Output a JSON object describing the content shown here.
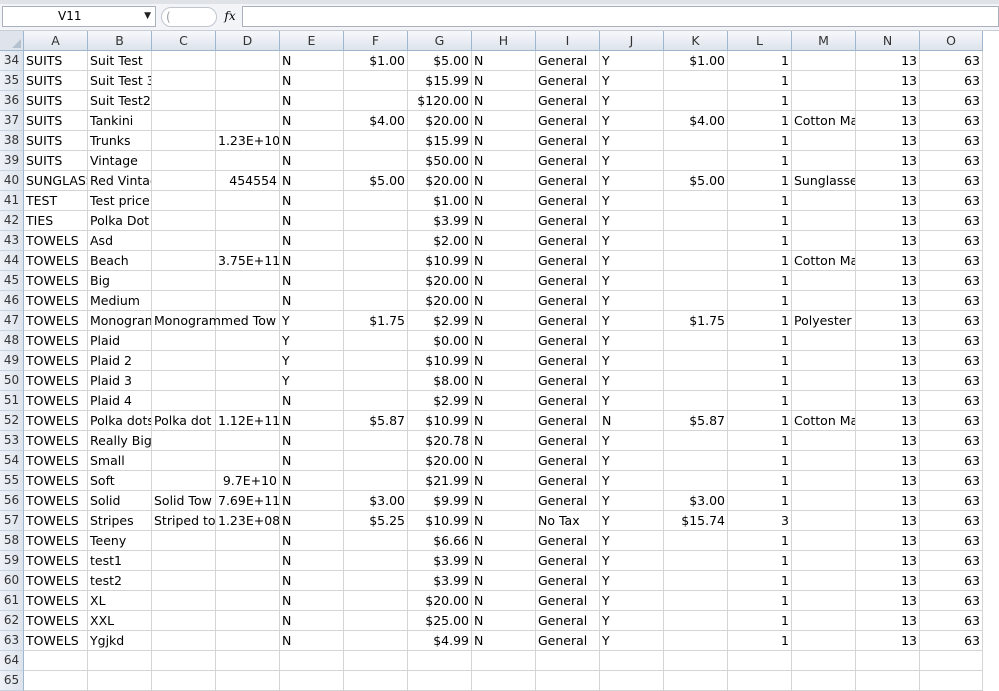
{
  "formula_bar": {
    "name_box": "V11",
    "fx_label": "fx",
    "formula": ""
  },
  "columns": [
    "A",
    "B",
    "C",
    "D",
    "E",
    "F",
    "G",
    "H",
    "I",
    "J",
    "K",
    "L",
    "M",
    "N",
    "O"
  ],
  "rows": [
    {
      "num": "34",
      "cells": [
        "SUITS",
        "Suit Test",
        "",
        "",
        "N",
        "$1.00",
        "$5.00",
        "N",
        "General",
        "Y",
        "$1.00",
        "1",
        "",
        "13",
        "63"
      ]
    },
    {
      "num": "35",
      "cells": [
        "SUITS",
        "Suit Test 3",
        "",
        "",
        "N",
        "",
        "$15.99",
        "N",
        "General",
        "Y",
        "",
        "1",
        "",
        "13",
        "63"
      ]
    },
    {
      "num": "36",
      "cells": [
        "SUITS",
        "Suit Test2",
        "",
        "",
        "N",
        "",
        "$120.00",
        "N",
        "General",
        "Y",
        "",
        "1",
        "",
        "13",
        "63"
      ]
    },
    {
      "num": "37",
      "cells": [
        "SUITS",
        "Tankini",
        "",
        "",
        "N",
        "$4.00",
        "$20.00",
        "N",
        "General",
        "Y",
        "$4.00",
        "1",
        "Cotton Ma",
        "13",
        "63"
      ]
    },
    {
      "num": "38",
      "cells": [
        "SUITS",
        "Trunks",
        "",
        "1.23E+10",
        "N",
        "",
        "$15.99",
        "N",
        "General",
        "Y",
        "",
        "1",
        "",
        "13",
        "63"
      ]
    },
    {
      "num": "39",
      "cells": [
        "SUITS",
        "Vintage",
        "",
        "",
        "N",
        "",
        "$50.00",
        "N",
        "General",
        "Y",
        "",
        "1",
        "",
        "13",
        "63"
      ]
    },
    {
      "num": "40",
      "cells": [
        "SUNGLASS",
        "Red Vintage",
        "",
        "454554",
        "N",
        "$5.00",
        "$20.00",
        "N",
        "General",
        "Y",
        "$5.00",
        "1",
        "Sunglasse",
        "13",
        "63"
      ]
    },
    {
      "num": "41",
      "cells": [
        "TEST",
        "Test price",
        "",
        "",
        "N",
        "",
        "$1.00",
        "N",
        "General",
        "Y",
        "",
        "1",
        "",
        "13",
        "63"
      ]
    },
    {
      "num": "42",
      "cells": [
        "TIES",
        "Polka Dot",
        "",
        "",
        "N",
        "",
        "$3.99",
        "N",
        "General",
        "Y",
        "",
        "1",
        "",
        "13",
        "63"
      ]
    },
    {
      "num": "43",
      "cells": [
        "TOWELS",
        "Asd",
        "",
        "",
        "N",
        "",
        "$2.00",
        "N",
        "General",
        "Y",
        "",
        "1",
        "",
        "13",
        "63"
      ]
    },
    {
      "num": "44",
      "cells": [
        "TOWELS",
        "Beach",
        "",
        "3.75E+11",
        "N",
        "",
        "$10.99",
        "N",
        "General",
        "Y",
        "",
        "1",
        "Cotton Ma",
        "13",
        "63"
      ]
    },
    {
      "num": "45",
      "cells": [
        "TOWELS",
        "Big",
        "",
        "",
        "N",
        "",
        "$20.00",
        "N",
        "General",
        "Y",
        "",
        "1",
        "",
        "13",
        "63"
      ]
    },
    {
      "num": "46",
      "cells": [
        "TOWELS",
        "Medium",
        "",
        "",
        "N",
        "",
        "$20.00",
        "N",
        "General",
        "Y",
        "",
        "1",
        "",
        "13",
        "63"
      ]
    },
    {
      "num": "47",
      "cells": [
        "TOWELS",
        "Monogran",
        "Monogrammed Tow",
        "",
        "Y",
        "$1.75",
        "$2.99",
        "N",
        "General",
        "Y",
        "$1.75",
        "1",
        "Polyester",
        "13",
        "63"
      ]
    },
    {
      "num": "48",
      "cells": [
        "TOWELS",
        "Plaid",
        "",
        "",
        "Y",
        "",
        "$0.00",
        "N",
        "General",
        "Y",
        "",
        "1",
        "",
        "13",
        "63"
      ]
    },
    {
      "num": "49",
      "cells": [
        "TOWELS",
        "Plaid 2",
        "",
        "",
        "Y",
        "",
        "$10.99",
        "N",
        "General",
        "Y",
        "",
        "1",
        "",
        "13",
        "63"
      ]
    },
    {
      "num": "50",
      "cells": [
        "TOWELS",
        "Plaid 3",
        "",
        "",
        "Y",
        "",
        "$8.00",
        "N",
        "General",
        "Y",
        "",
        "1",
        "",
        "13",
        "63"
      ]
    },
    {
      "num": "51",
      "cells": [
        "TOWELS",
        "Plaid 4",
        "",
        "",
        "N",
        "",
        "$2.99",
        "N",
        "General",
        "Y",
        "",
        "1",
        "",
        "13",
        "63"
      ]
    },
    {
      "num": "52",
      "cells": [
        "TOWELS",
        "Polka dots",
        "Polka dot",
        "1.12E+11",
        "N",
        "$5.87",
        "$10.99",
        "N",
        "General",
        "N",
        "$5.87",
        "1",
        "Cotton Ma",
        "13",
        "63"
      ]
    },
    {
      "num": "53",
      "cells": [
        "TOWELS",
        "Really Big",
        "",
        "",
        "N",
        "",
        "$20.78",
        "N",
        "General",
        "Y",
        "",
        "1",
        "",
        "13",
        "63"
      ]
    },
    {
      "num": "54",
      "cells": [
        "TOWELS",
        "Small",
        "",
        "",
        "N",
        "",
        "$20.00",
        "N",
        "General",
        "Y",
        "",
        "1",
        "",
        "13",
        "63"
      ]
    },
    {
      "num": "55",
      "cells": [
        "TOWELS",
        "Soft",
        "",
        "9.7E+10",
        "N",
        "",
        "$21.99",
        "N",
        "General",
        "Y",
        "",
        "1",
        "",
        "13",
        "63"
      ]
    },
    {
      "num": "56",
      "cells": [
        "TOWELS",
        "Solid",
        "Solid Tow",
        "7.69E+11",
        "N",
        "$3.00",
        "$9.99",
        "N",
        "General",
        "Y",
        "$3.00",
        "1",
        "",
        "13",
        "63"
      ]
    },
    {
      "num": "57",
      "cells": [
        "TOWELS",
        "Stripes",
        "Striped to",
        "1.23E+08",
        "N",
        "$5.25",
        "$10.99",
        "N",
        "No Tax",
        "Y",
        "$15.74",
        "3",
        "",
        "13",
        "63"
      ]
    },
    {
      "num": "58",
      "cells": [
        "TOWELS",
        "Teeny",
        "",
        "",
        "N",
        "",
        "$6.66",
        "N",
        "General",
        "Y",
        "",
        "1",
        "",
        "13",
        "63"
      ]
    },
    {
      "num": "59",
      "cells": [
        "TOWELS",
        "test1",
        "",
        "",
        "N",
        "",
        "$3.99",
        "N",
        "General",
        "Y",
        "",
        "1",
        "",
        "13",
        "63"
      ]
    },
    {
      "num": "60",
      "cells": [
        "TOWELS",
        "test2",
        "",
        "",
        "N",
        "",
        "$3.99",
        "N",
        "General",
        "Y",
        "",
        "1",
        "",
        "13",
        "63"
      ]
    },
    {
      "num": "61",
      "cells": [
        "TOWELS",
        "XL",
        "",
        "",
        "N",
        "",
        "$20.00",
        "N",
        "General",
        "Y",
        "",
        "1",
        "",
        "13",
        "63"
      ]
    },
    {
      "num": "62",
      "cells": [
        "TOWELS",
        "XXL",
        "",
        "",
        "N",
        "",
        "$25.00",
        "N",
        "General",
        "Y",
        "",
        "1",
        "",
        "13",
        "63"
      ]
    },
    {
      "num": "63",
      "cells": [
        "TOWELS",
        "Ygjkd",
        "",
        "",
        "N",
        "",
        "$4.99",
        "N",
        "General",
        "Y",
        "",
        "1",
        "",
        "13",
        "63"
      ]
    },
    {
      "num": "64",
      "cells": [
        "",
        "",
        "",
        "",
        "",
        "",
        "",
        "",
        "",
        "",
        "",
        "",
        "",
        "",
        ""
      ]
    },
    {
      "num": "65",
      "cells": [
        "",
        "",
        "",
        "",
        "",
        "",
        "",
        "",
        "",
        "",
        "",
        "",
        "",
        "",
        ""
      ]
    }
  ]
}
